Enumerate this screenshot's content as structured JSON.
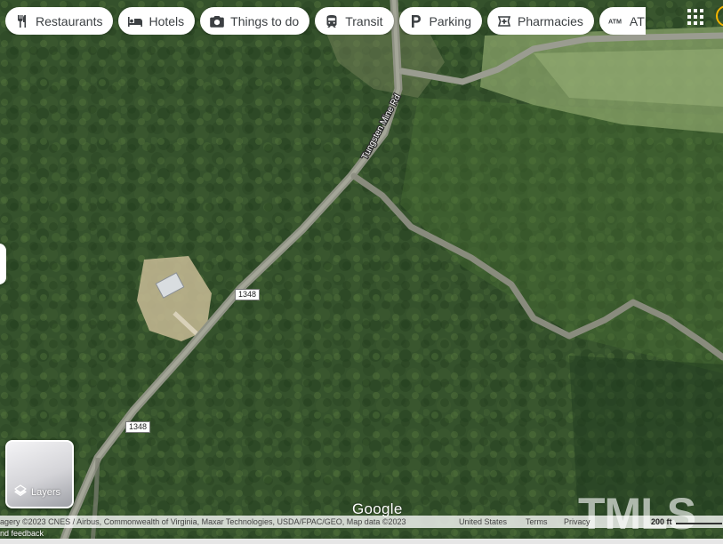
{
  "category_chips": [
    {
      "label": "Restaurants",
      "icon": "fork-knife-icon"
    },
    {
      "label": "Hotels",
      "icon": "bed-icon"
    },
    {
      "label": "Things to do",
      "icon": "camera-icon"
    },
    {
      "label": "Transit",
      "icon": "train-icon"
    },
    {
      "label": "Parking",
      "icon": "parking-icon"
    },
    {
      "label": "Pharmacies",
      "icon": "pharmacy-icon"
    },
    {
      "label": "ATMs",
      "icon": "atm-icon"
    }
  ],
  "map": {
    "street_label": "Tungsten Mine Rd",
    "route_shields": [
      "1348",
      "1348"
    ]
  },
  "layers_button": {
    "label": "Layers",
    "icon": "layers-icon"
  },
  "google_logo": "Google",
  "attribution": {
    "imagery": "agery ©2023 CNES / Airbus, Commonwealth of Virginia, Maxar Technologies, USDA/FPAC/GEO, Map data ©2023",
    "region": "United States",
    "terms": "Terms",
    "privacy": "Privacy",
    "feedback": "nd feedback"
  },
  "scale": {
    "label": "200 ft"
  },
  "watermark": "TMLS"
}
